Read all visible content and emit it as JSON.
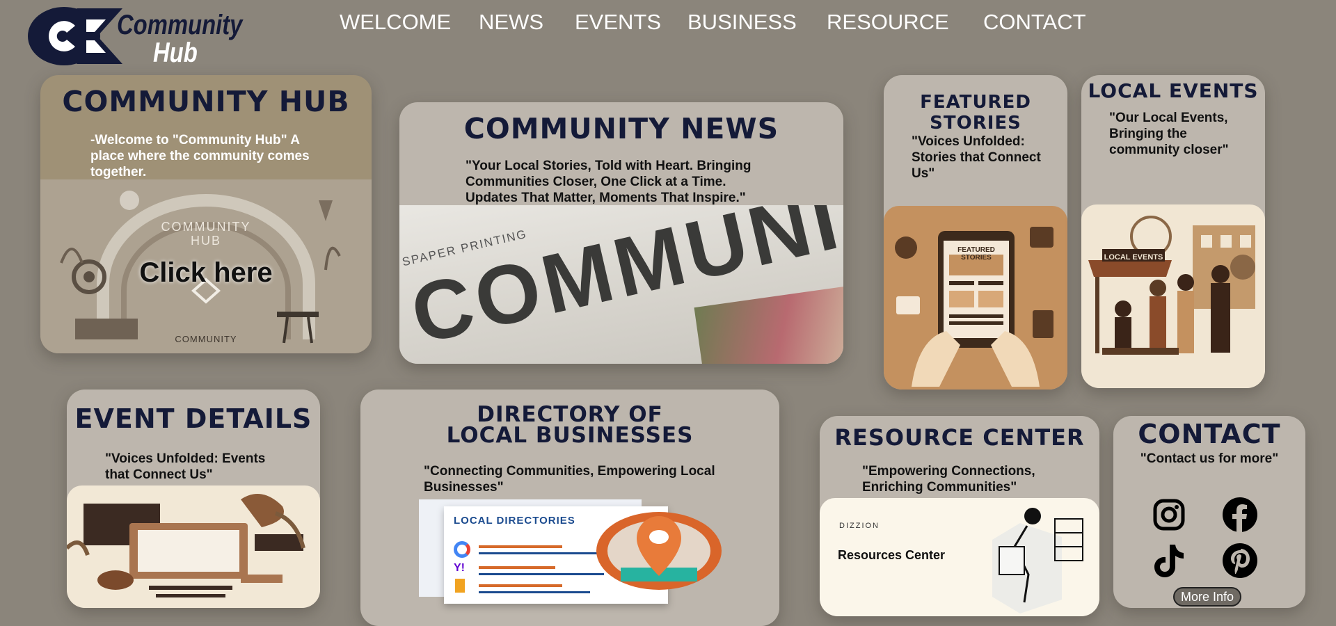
{
  "brand": {
    "line1": "Community",
    "line2": "Hub"
  },
  "nav": [
    {
      "label": "WELCOME"
    },
    {
      "label": "NEWS"
    },
    {
      "label": "EVENTS"
    },
    {
      "label": "BUSINESS"
    },
    {
      "label": "RESOURCE"
    },
    {
      "label": "CONTACT"
    }
  ],
  "hub": {
    "title": "COMMUNITY HUB",
    "text": "-Welcome to \"Community Hub\" A place where the community comes together.",
    "cta": "Click here",
    "img_text_top": "COMMUNITY",
    "img_text_mid": "HUB",
    "img_text_bottom": "COMMUNITY"
  },
  "news": {
    "title": "COMMUNITY NEWS",
    "text": "\"Your Local Stories, Told with Heart. Bringing Communities Closer, One Click at a Time. Updates That Matter, Moments That Inspire.\"",
    "img_headline": "COMMUNI",
    "img_caption": "SPAPER PRINTING"
  },
  "featured": {
    "title": "FEATURED STORIES",
    "text": "\"Voices Unfolded: Stories that Connect Us\"",
    "img_label": "FEATURED STORIES"
  },
  "local_events": {
    "title": "LOCAL EVENTS",
    "text": "\"Our Local Events, Bringing the community closer\"",
    "img_label": "LOCAL EVENTS"
  },
  "event_details": {
    "title": "EVENT DETAILS",
    "text": "\"Voices Unfolded: Events that Connect Us\""
  },
  "directory": {
    "title_line1": "DIRECTORY OF",
    "title_line2": "LOCAL BUSINESSES",
    "text": "\"Connecting Communities, Empowering Local Businesses\"",
    "img_label": "LOCAL DIRECTORIES"
  },
  "resource": {
    "title": "RESOURCE CENTER",
    "text": "\"Empowering Connections, Enriching Communities\"",
    "img_brand": "DIZZION",
    "img_label": "Resources Center"
  },
  "contact": {
    "title": "CONTACT",
    "text": "\"Contact us for more\"",
    "button": "More Info",
    "socials": [
      "instagram-icon",
      "facebook-icon",
      "tiktok-icon",
      "pinterest-icon"
    ]
  }
}
